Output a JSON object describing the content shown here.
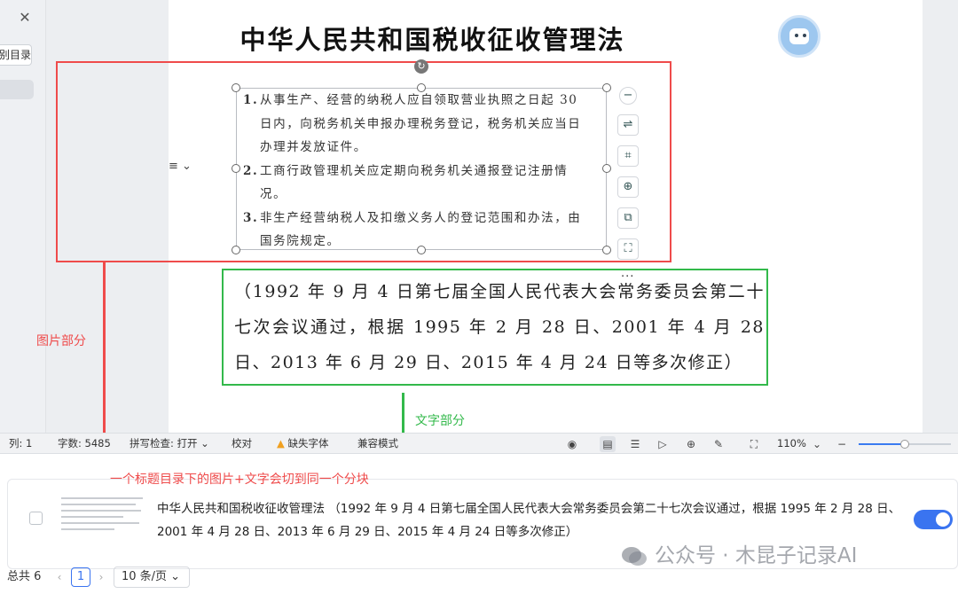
{
  "left_panel": {
    "close_glyph": "✕",
    "directory_button": "别目录"
  },
  "document": {
    "title": "中华人民共和国税收征收管理法",
    "image_content": [
      {
        "num": "1.",
        "text": "从事生产、经营的纳税人应自领取营业执照之日起 30 日内，向税务机关申报办理税务登记，税务机关应当日办理并发放证件。"
      },
      {
        "num": "2.",
        "text": "工商行政管理机关应定期向税务机关通报登记注册情况。"
      },
      {
        "num": "3.",
        "text": "非生产经营纳税人及扣缴义务人的登记范围和办法，由国务院规定。"
      }
    ],
    "text_content": "（1992 年 9 月 4 日第七届全国人民代表大会常务委员会第二十七次会议通过，根据 1995 年 2 月 28 日、2001 年 4 月 28 日、2013 年 6 月 29 日、2015 年 4 月 24 日等多次修正）"
  },
  "annotations": {
    "image_part_label": "图片部分",
    "text_part_label": "文字部分",
    "chunk_note": "一个标题目录下的图片+文字会切到同一个分块"
  },
  "image_tools": {
    "align_glyph": "≡ ⌄",
    "tool_icons": [
      "−",
      "⇌",
      "⌗",
      "⊕",
      "⧉",
      "⛶"
    ],
    "more": "···"
  },
  "status_bar": {
    "line": "列: 1",
    "word_count": "字数: 5485",
    "spell_check": "拼写检查: 打开",
    "proofread": "校对",
    "missing_font": "缺失字体",
    "compat_mode": "兼容模式",
    "zoom": "110%",
    "zoom_fraction": 0.5
  },
  "chunk_list": {
    "items": [
      {
        "text": "中华人民共和国税收征收管理法 （1992 年 9 月 4 日第七届全国人民代表大会常务委员会第二十七次会议通过，根据 1995 年 2 月 28 日、2001 年 4 月 28 日、2013 年 6 月 29 日、2015 年 4 月 24 日等多次修正）",
        "enabled": true
      }
    ],
    "total": "总共 6",
    "current_page": "1",
    "page_size": "10 条/页 ⌄",
    "prev": "‹",
    "next": "›"
  },
  "watermark": {
    "text": "公众号 · 木昆子记录AI"
  },
  "colors": {
    "red_box": "#ef4b4b",
    "green_box": "#33b94b",
    "accent": "#3a74f0"
  }
}
